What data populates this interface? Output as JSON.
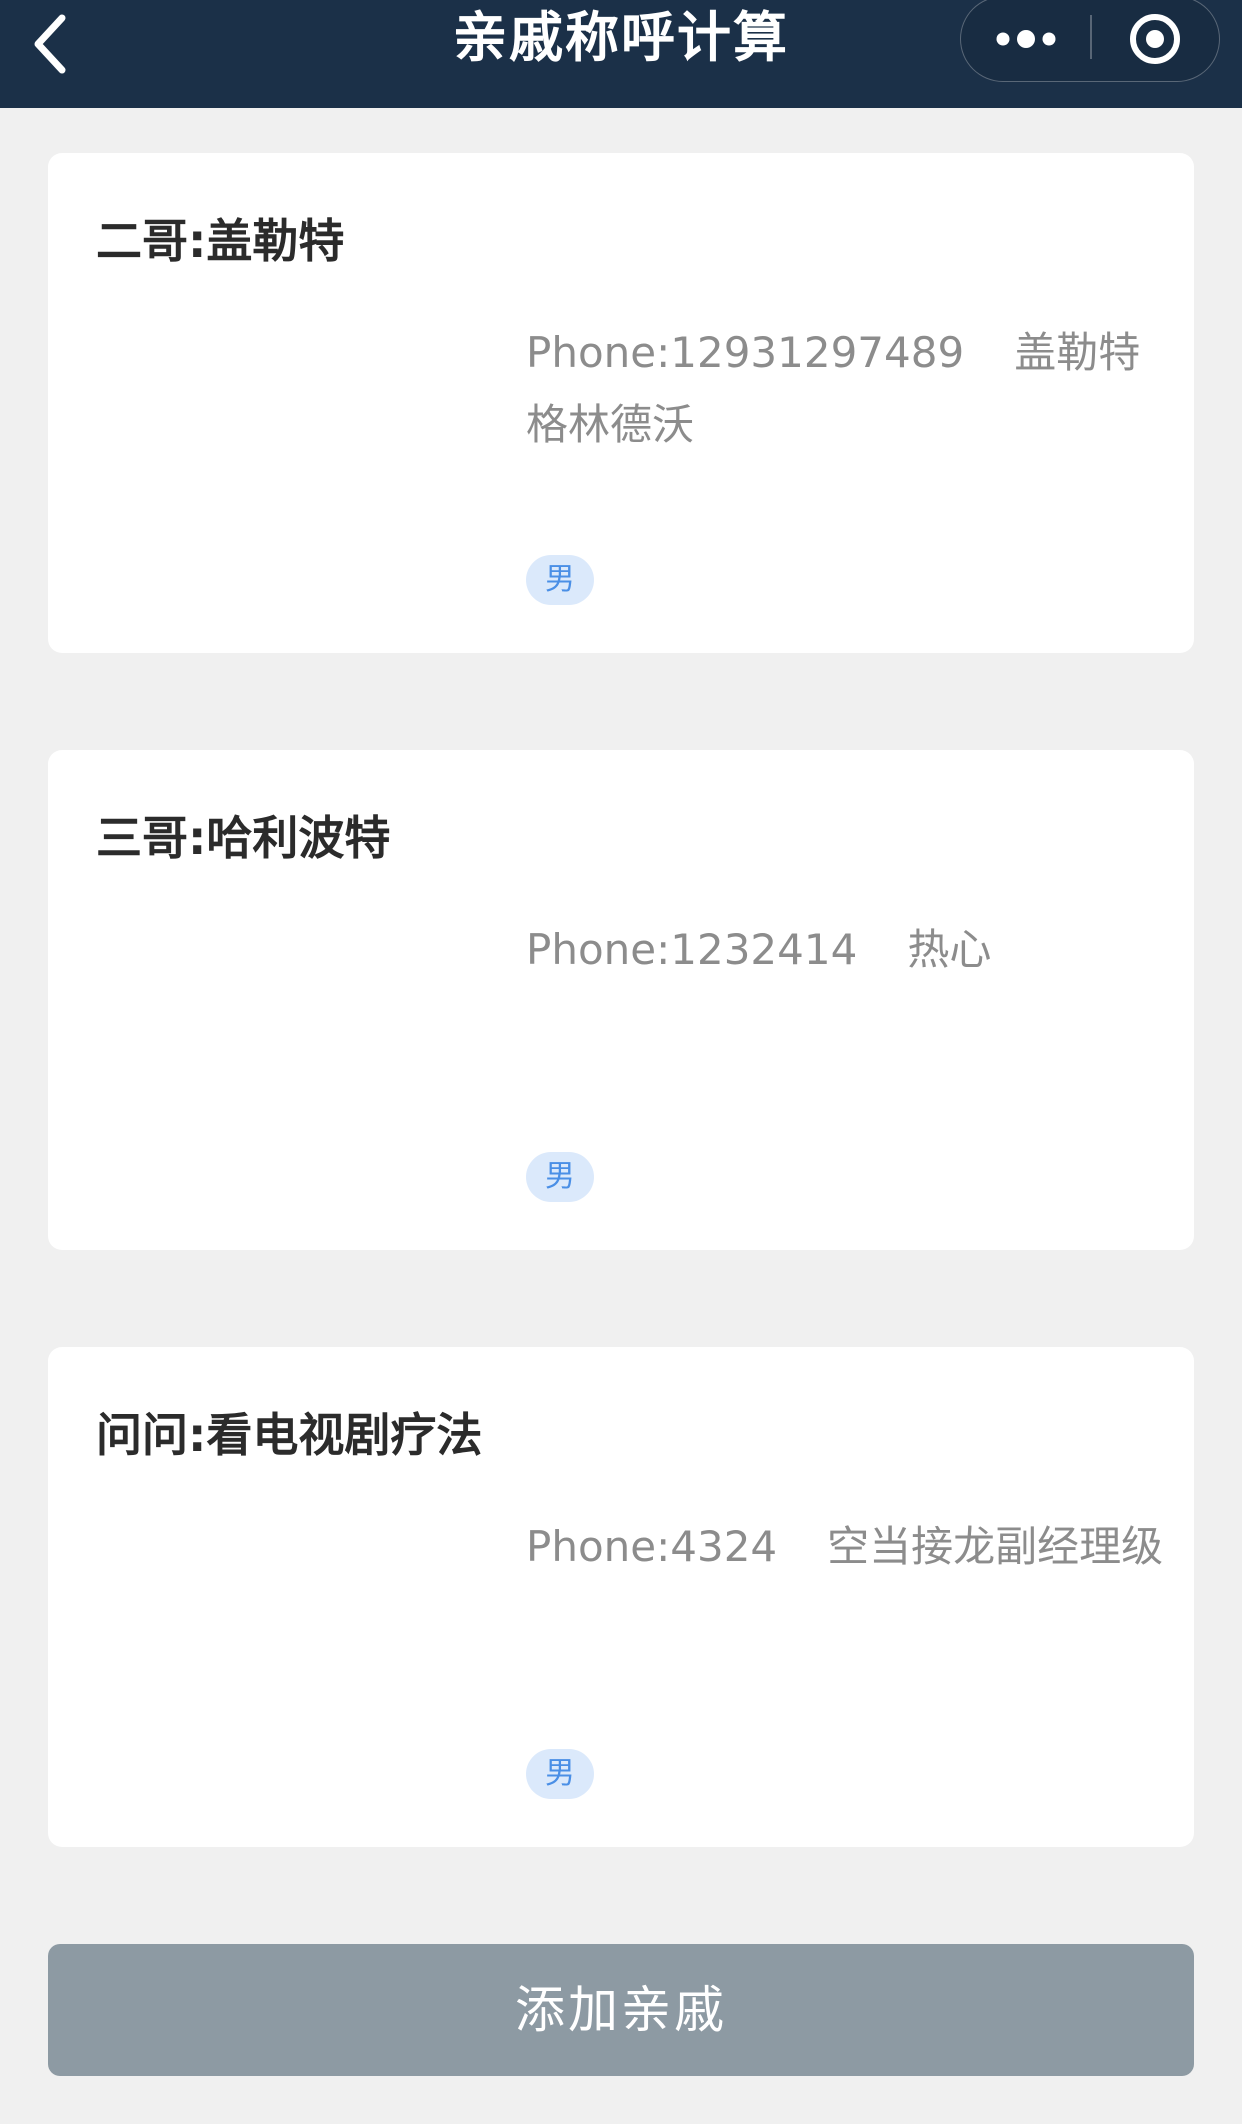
{
  "navbar": {
    "title": "亲戚称呼计算",
    "back_icon": "chevron-left-icon",
    "more_icon": "more-dots-icon",
    "close_icon": "target-close-icon",
    "background": "#1b3048"
  },
  "relatives": [
    {
      "title": "二哥:盖勒特",
      "phone": "Phone:12931297489",
      "note": "盖勒特格林德沃",
      "gender": "男"
    },
    {
      "title": "三哥:哈利波特",
      "phone": "Phone:1232414",
      "note": "热心",
      "gender": "男"
    },
    {
      "title": "问问:看电视剧疗法",
      "phone": "Phone:4324",
      "note": "空当接龙副经理级",
      "gender": "男"
    }
  ],
  "add_button": {
    "label": "添加亲戚",
    "background": "#8d9aa3"
  },
  "colors": {
    "page_bg": "#f0f0f0",
    "tag_bg": "#dbe9fb",
    "tag_text": "#4a8fe6"
  }
}
